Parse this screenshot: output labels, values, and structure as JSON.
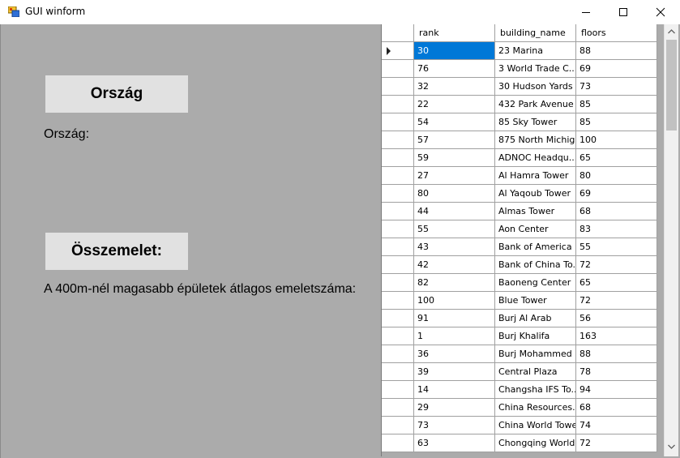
{
  "window": {
    "title": "GUI winform",
    "controls": [
      "minimize-icon",
      "maximize-icon",
      "close-icon"
    ]
  },
  "left_panel": {
    "country_button": "Ország",
    "country_label": "Ország:",
    "summary_button": "Összemelet:",
    "summary_label": "A 400m-nél magasabb épületek átlagos emeletszáma:"
  },
  "grid": {
    "columns": [
      "rank",
      "building_name",
      "floors"
    ],
    "selected_row": 0,
    "rows": [
      {
        "rank": "30",
        "building_name": "23 Marina",
        "floors": "88"
      },
      {
        "rank": "76",
        "building_name": "3 World Trade C...",
        "floors": "69"
      },
      {
        "rank": "32",
        "building_name": "30 Hudson Yards",
        "floors": "73"
      },
      {
        "rank": "22",
        "building_name": "432 Park Avenue",
        "floors": "85"
      },
      {
        "rank": "54",
        "building_name": "85 Sky Tower",
        "floors": "85"
      },
      {
        "rank": "57",
        "building_name": "875 North Michig...",
        "floors": "100"
      },
      {
        "rank": "59",
        "building_name": "ADNOC Headqu...",
        "floors": "65"
      },
      {
        "rank": "27",
        "building_name": "Al Hamra Tower",
        "floors": "80"
      },
      {
        "rank": "80",
        "building_name": "Al Yaqoub Tower",
        "floors": "69"
      },
      {
        "rank": "44",
        "building_name": "Almas Tower",
        "floors": "68"
      },
      {
        "rank": "55",
        "building_name": "Aon Center",
        "floors": "83"
      },
      {
        "rank": "43",
        "building_name": "Bank of America ...",
        "floors": "55"
      },
      {
        "rank": "42",
        "building_name": "Bank of China To...",
        "floors": "72"
      },
      {
        "rank": "82",
        "building_name": "Baoneng Center",
        "floors": "65"
      },
      {
        "rank": "100",
        "building_name": "Blue Tower",
        "floors": "72"
      },
      {
        "rank": "91",
        "building_name": "Burj Al Arab",
        "floors": "56"
      },
      {
        "rank": "1",
        "building_name": "Burj Khalifa",
        "floors": "163"
      },
      {
        "rank": "36",
        "building_name": "Burj Mohammed ...",
        "floors": "88"
      },
      {
        "rank": "39",
        "building_name": "Central Plaza",
        "floors": "78"
      },
      {
        "rank": "14",
        "building_name": "Changsha IFS To...",
        "floors": "94"
      },
      {
        "rank": "29",
        "building_name": "China Resources...",
        "floors": "68"
      },
      {
        "rank": "73",
        "building_name": "China World Tower",
        "floors": "74"
      },
      {
        "rank": "63",
        "building_name": "Chongqing World...",
        "floors": "72"
      }
    ]
  },
  "colors": {
    "form_background": "#ababab",
    "button_background": "#e1e1e1",
    "selection": "#0078d7"
  }
}
